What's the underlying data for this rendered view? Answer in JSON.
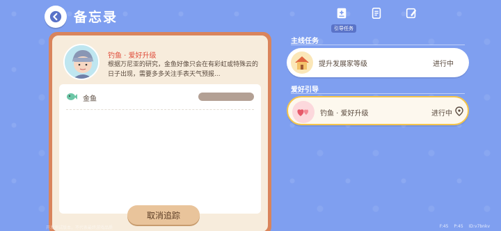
{
  "header": {
    "title": "备忘录"
  },
  "tabs": [
    {
      "icon": "guide-task-icon",
      "label": "引导任务",
      "active": true
    },
    {
      "icon": "notebook-icon",
      "label": "",
      "active": false
    },
    {
      "icon": "edit-note-icon",
      "label": "",
      "active": false
    }
  ],
  "quest": {
    "title": "钓鱼 · 爱好升级",
    "description": "根据万尼亚的研究，金鱼好像只会在有彩虹或特殊云的日子出现，需要多多关注手表天气预报...",
    "task_label": "金鱼",
    "cancel_label": "取消追踪"
  },
  "sections": [
    {
      "label": "主线任务",
      "items": [
        {
          "name": "提升发展家等级",
          "status": "进行中",
          "icon": "house-icon",
          "active": false
        }
      ]
    },
    {
      "label": "爱好引导",
      "items": [
        {
          "name": "钓鱼 · 爱好升级",
          "status": "进行中",
          "icon": "hearts-icon",
          "active": true
        }
      ]
    }
  ],
  "footer": {
    "note": "开发测试版本，不代表最终游戏品质",
    "stats": [
      "F:45",
      "P:45",
      "ID:v7bnkv"
    ]
  },
  "colors": {
    "background": "#7f9ff0",
    "card_border": "#d9845c",
    "accent": "#f4c54b",
    "quest_title": "#e04e3c"
  }
}
